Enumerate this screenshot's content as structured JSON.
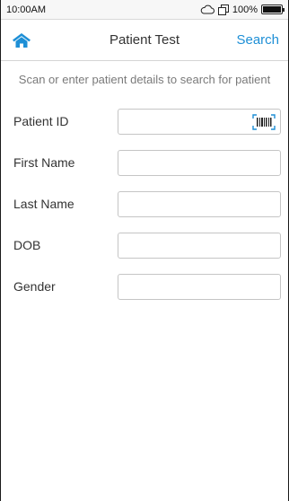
{
  "status_bar": {
    "time": "10:00AM",
    "battery": "100%",
    "icons": [
      "cloud-icon",
      "sync-icon",
      "battery-icon"
    ]
  },
  "navbar": {
    "title": "Patient Test",
    "action": "Search",
    "home_icon": "home-icon"
  },
  "hint": "Scan or enter patient details to search for patient",
  "form": {
    "fields": [
      {
        "label": "Patient ID",
        "value": "",
        "scan_icon": "barcode-scan-icon"
      },
      {
        "label": "First Name",
        "value": ""
      },
      {
        "label": "Last Name",
        "value": ""
      },
      {
        "label": "DOB",
        "value": ""
      },
      {
        "label": "Gender",
        "value": ""
      }
    ]
  },
  "colors": {
    "accent": "#1e8fd6",
    "hint_text": "#7a7a7a",
    "field_border": "#c5c5c5"
  }
}
